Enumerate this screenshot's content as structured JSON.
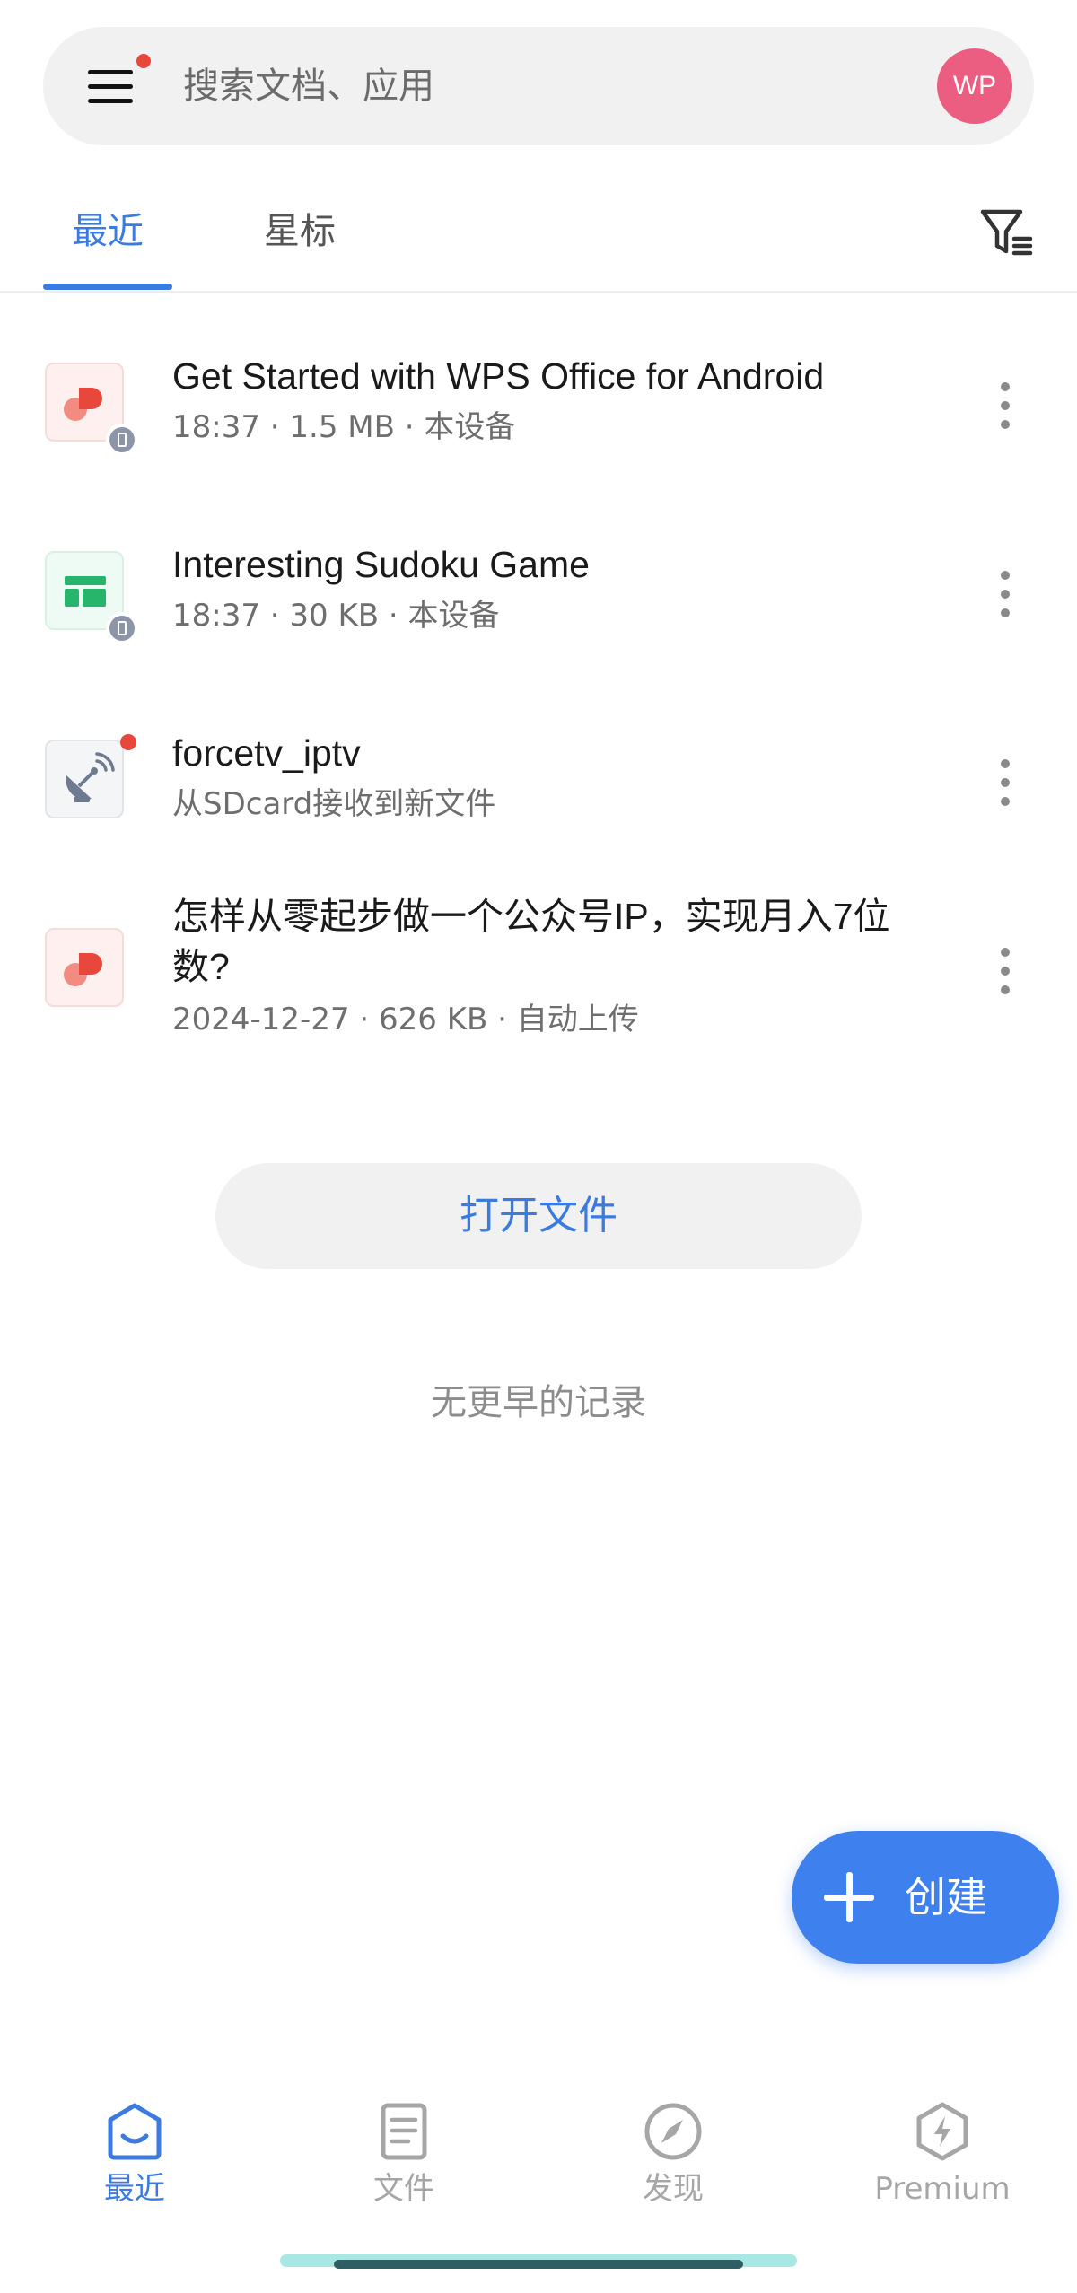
{
  "search": {
    "placeholder": "搜索文档、应用",
    "avatar_text": "WP"
  },
  "tabs": [
    {
      "label": "最近",
      "active": true
    },
    {
      "label": "星标",
      "active": false
    }
  ],
  "files": [
    {
      "name": "Get Started with WPS Office for Android",
      "meta": "18:37 · 1.5 MB · 本设备",
      "type": "pdf",
      "badge": "device-icon"
    },
    {
      "name": "Interesting Sudoku Game",
      "meta": "18:37 · 30 KB · 本设备",
      "type": "sheet",
      "badge": "device-icon"
    },
    {
      "name": "forcetv_iptv",
      "meta": "从SDcard接收到新文件",
      "type": "other",
      "badge": "new-dot"
    },
    {
      "name_line1": "怎样从零起步做一个公众号IP，实现月入7位",
      "name_line2": "数?",
      "meta": "2024-12-27 · 626 KB · 自动上传",
      "type": "pdf"
    }
  ],
  "open_file_label": "打开文件",
  "no_more_text": "无更早的记录",
  "create_label": "创建",
  "bottom_nav": [
    {
      "label": "最近",
      "icon": "home-icon",
      "active": true
    },
    {
      "label": "文件",
      "icon": "document-icon",
      "active": false
    },
    {
      "label": "发现",
      "icon": "compass-icon",
      "active": false
    },
    {
      "label": "Premium",
      "icon": "premium-icon",
      "active": false
    }
  ],
  "colors": {
    "accent": "#3b7be0",
    "fab": "#3f80ef",
    "avatar": "#ec5d82",
    "notification_dot": "#e8483b",
    "pdf_red": "#e8483b",
    "sheet_green": "#27b56b"
  }
}
